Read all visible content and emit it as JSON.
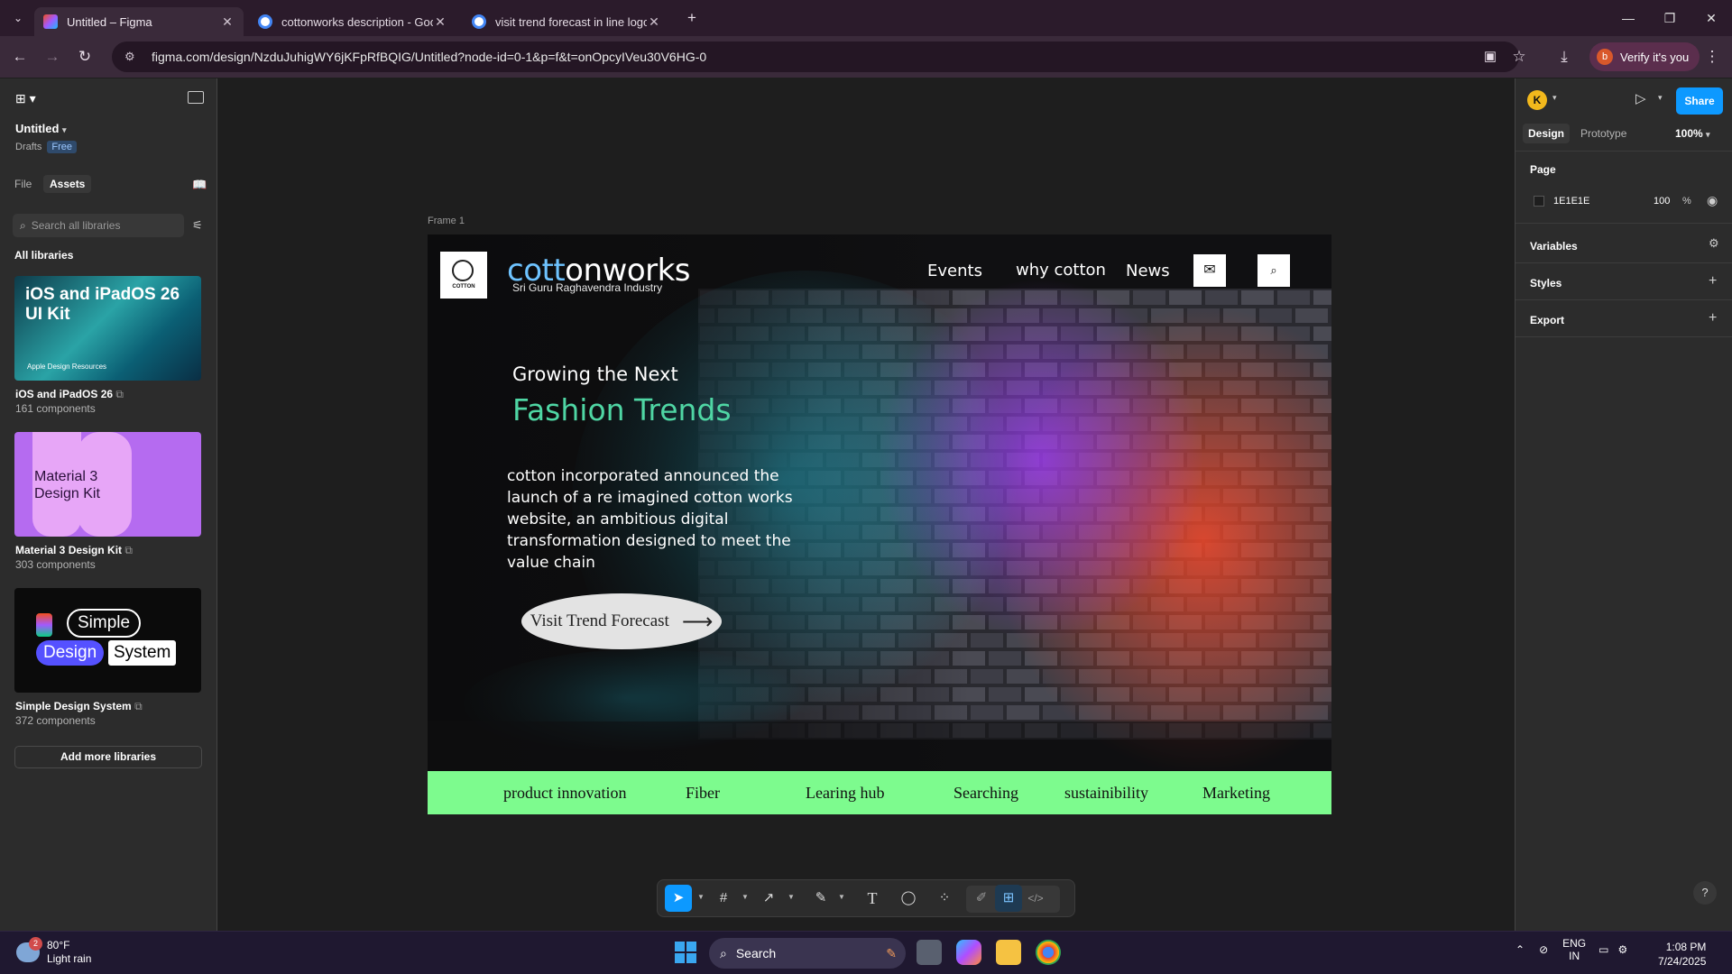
{
  "browser": {
    "tabs": [
      {
        "title": "Untitled – Figma",
        "active": true
      },
      {
        "title": "cottonworks description - Goog",
        "active": false
      },
      {
        "title": "visit trend forecast in line logo",
        "active": false
      }
    ],
    "url": "figma.com/design/NzduJuhigWY6jKFpRfBQIG/Untitled?node-id=0-1&p=f&t=onOpcyIVeu30V6HG-0",
    "verify_label": "Verify it's you",
    "profile_initial": "b"
  },
  "figma_left": {
    "file_name": "Untitled",
    "drafts_label": "Drafts",
    "plan_badge": "Free",
    "tab_file": "File",
    "tab_assets": "Assets",
    "search_placeholder": "Search all libraries",
    "all_libraries": "All libraries",
    "libraries": [
      {
        "name": "iOS and iPadOS 26",
        "count": "161 components",
        "thumb_title": "iOS and iPadOS 26 UI Kit",
        "thumb_sub": "Apple Design Resources"
      },
      {
        "name": "Material 3 Design Kit",
        "count": "303 components",
        "thumb_title": "Material 3 Design Kit"
      },
      {
        "name": "Simple Design System",
        "count": "372 components",
        "thumb_words": [
          "Simple",
          "Design",
          "System"
        ]
      }
    ],
    "add_more": "Add more libraries"
  },
  "canvas": {
    "frame_label": "Frame 1",
    "site": {
      "logo_text": "COTTON",
      "brand_part1": "cott",
      "brand_part2": "onworks",
      "tagline": "Sri Guru Raghavendra Industry",
      "nav": [
        "Events",
        "why cotton",
        "News"
      ],
      "heading_small": "Growing the Next",
      "heading_large": "Fashion Trends",
      "description": "cotton incorporated announced the launch of a re imagined cotton works website, an ambitious digital transformation designed to meet the value chain",
      "cta_label": "Visit Trend Forecast",
      "bottom_nav": [
        "product innovation",
        "Fiber",
        "Learing  hub",
        "Searching",
        "sustainibility",
        "Marketing"
      ]
    }
  },
  "figma_right": {
    "user_initial": "K",
    "share_label": "Share",
    "tab_design": "Design",
    "tab_prototype": "Prototype",
    "zoom": "100%",
    "page_section": "Page",
    "page_color": "1E1E1E",
    "page_opacity": "100",
    "percent": "%",
    "variables": "Variables",
    "styles": "Styles",
    "export": "Export",
    "help": "?"
  },
  "taskbar": {
    "weather_temp": "80°F",
    "weather_desc": "Light rain",
    "weather_badge": "2",
    "search_label": "Search",
    "lang_top": "ENG",
    "lang_bottom": "IN",
    "time": "1:08 PM",
    "date": "7/24/2025"
  },
  "colors": {
    "figma_blue": "#0d99ff",
    "hero_green": "#4fd6a4",
    "bottom_bar_green": "#7dfb8e",
    "brand_blue": "#6ec3ff"
  }
}
